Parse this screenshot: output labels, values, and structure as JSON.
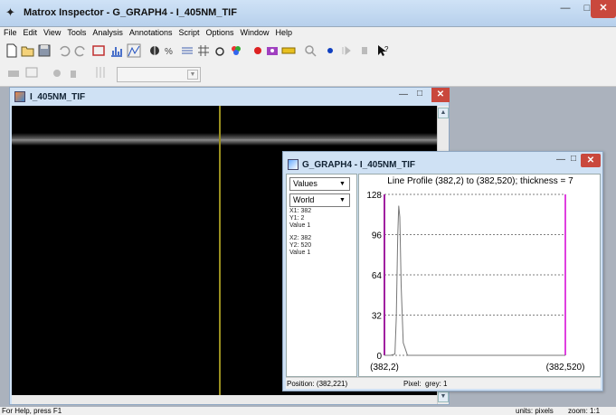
{
  "app": {
    "title": "Matrox Inspector - G_GRAPH4 - I_405NM_TIF"
  },
  "menu": [
    "File",
    "Edit",
    "View",
    "Tools",
    "Analysis",
    "Annotations",
    "Script",
    "Options",
    "Window",
    "Help"
  ],
  "image_window": {
    "title": "I_405NM_TIF"
  },
  "graph_window": {
    "title": "G_GRAPH4 - I_405NM_TIF",
    "dropdown_mode": "Values",
    "dropdown_coord": "World",
    "point1": [
      "X1: 382",
      "Y1: 2",
      "Value 1"
    ],
    "point2": [
      "X2: 382",
      "Y2: 520",
      "Value 1"
    ],
    "status_position": "Position: (382,221)",
    "status_pixel": "Pixel:",
    "status_grey": "grey: 1"
  },
  "chart_data": {
    "type": "line",
    "title": "Line Profile (382,2) to (382,520); thickness = 7",
    "ylim": [
      0,
      128
    ],
    "yticks": [
      0,
      32,
      64,
      96,
      128
    ],
    "x_label_start": "(382,2)",
    "x_label_end": "(382,520)",
    "xlim": [
      2,
      520
    ],
    "series": [
      {
        "x": [
          2,
          20,
          32,
          36,
          40,
          43,
          46,
          50,
          56,
          68,
          520
        ],
        "values": [
          0,
          0,
          1,
          30,
          95,
          119,
          110,
          55,
          10,
          0,
          0
        ]
      }
    ],
    "grid": true,
    "colors": {
      "axis": "#a020a0",
      "line": "#777777",
      "grid": "#555555"
    }
  },
  "statusbar": {
    "help": "For Help, press F1",
    "units": "units: pixels",
    "zoom": "zoom: 1:1"
  }
}
